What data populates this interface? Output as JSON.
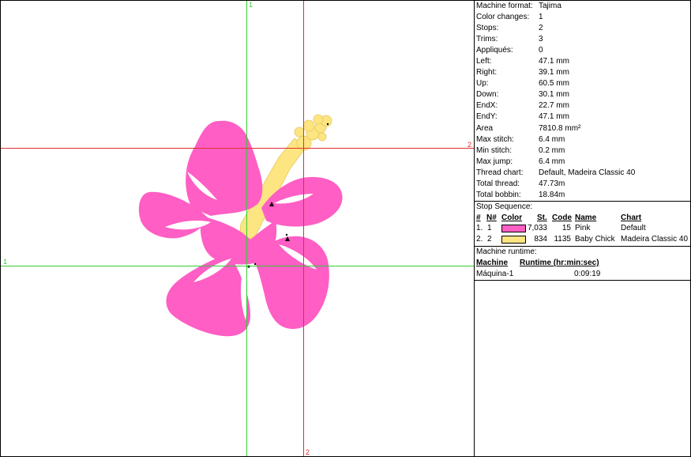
{
  "guides": {
    "v1": "1",
    "v2": "2",
    "h1": "1",
    "h2": "2"
  },
  "colors": {
    "pink": "#ff5ec4",
    "yellow": "#fde581",
    "guide_green": "#33cc33",
    "guide_red": "#e03030"
  },
  "stats": [
    {
      "label": "Machine format:",
      "value": "Tajima"
    },
    {
      "label": "Color changes:",
      "value": "1"
    },
    {
      "label": "Stops:",
      "value": "2"
    },
    {
      "label": "Trims:",
      "value": "3"
    },
    {
      "label": "Appliqués:",
      "value": "0"
    },
    {
      "label": "Left:",
      "value": "47.1 mm"
    },
    {
      "label": "Right:",
      "value": "39.1 mm"
    },
    {
      "label": "Up:",
      "value": "60.5 mm"
    },
    {
      "label": "Down:",
      "value": "30.1 mm"
    },
    {
      "label": "EndX:",
      "value": "22.7 mm"
    },
    {
      "label": "EndY:",
      "value": "47.1 mm"
    },
    {
      "label": "Area",
      "value": "7810.8 mm²"
    },
    {
      "label": "Max stitch:",
      "value": "6.4 mm"
    },
    {
      "label": "Min stitch:",
      "value": "0.2 mm"
    },
    {
      "label": "Max jump:",
      "value": "6.4 mm"
    },
    {
      "label": "Thread chart:",
      "value": "Default, Madeira Classic 40"
    },
    {
      "label": "Total thread:",
      "value": "47.73m"
    },
    {
      "label": "Total bobbin:",
      "value": "18.84m"
    }
  ],
  "stop_sequence": {
    "title": "Stop Sequence:",
    "headers": {
      "num": "#",
      "n": "N#",
      "color": "Color",
      "st": "St.",
      "code": "Code",
      "name": "Name",
      "chart": "Chart"
    },
    "rows": [
      {
        "num": "1.",
        "n": "1",
        "color": "#ff5ec4",
        "st": "7,033",
        "code": "15",
        "name": "Pink",
        "chart": "Default"
      },
      {
        "num": "2.",
        "n": "2",
        "color": "#fde581",
        "st": "834",
        "code": "1135",
        "name": "Baby Chick",
        "chart": "Madeira Classic 40"
      }
    ]
  },
  "runtime": {
    "title": "Machine runtime:",
    "headers": {
      "machine": "Machine",
      "runtime": "Runtime (hr:min:sec)"
    },
    "rows": [
      {
        "machine": "Máquina-1",
        "runtime": "0:09:19"
      }
    ]
  }
}
